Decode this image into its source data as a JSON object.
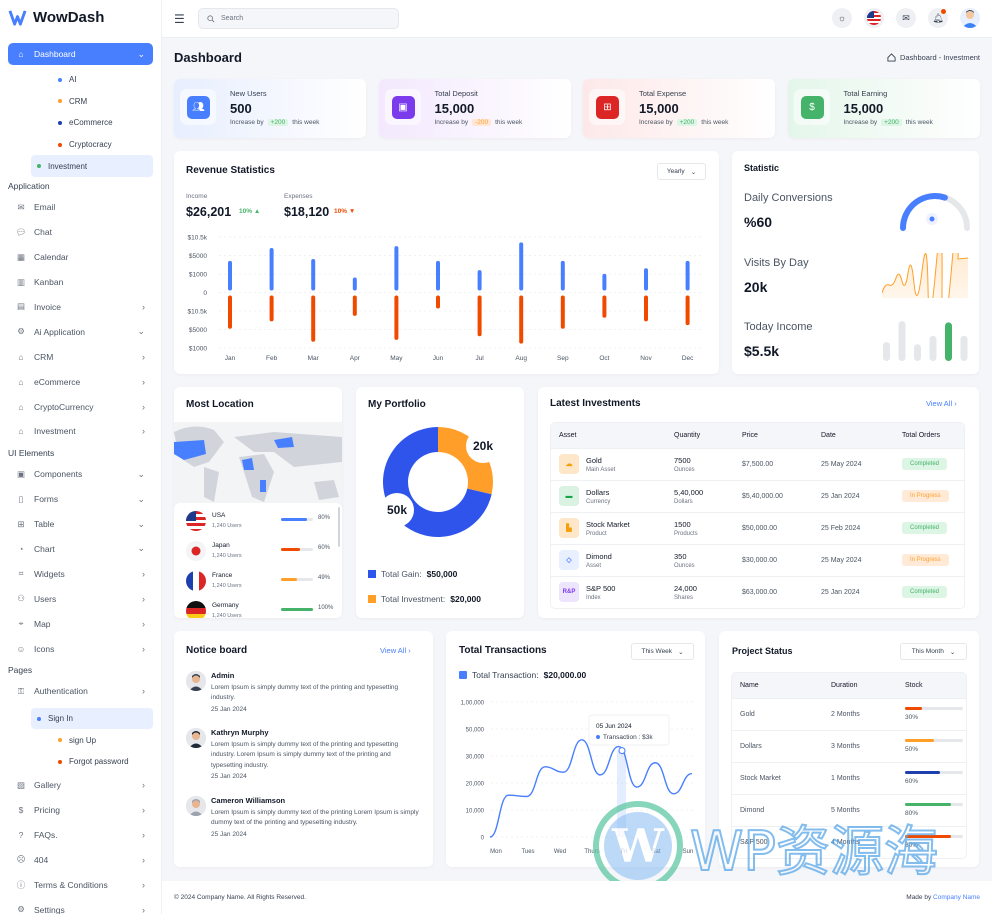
{
  "app": {
    "name": "WowDash"
  },
  "sidebar": {
    "dashboard": {
      "label": "Dashboard",
      "children": [
        {
          "label": "AI",
          "color": "#487fff"
        },
        {
          "label": "CRM",
          "color": "#ff9f29"
        },
        {
          "label": "eCommerce",
          "color": "#1e40af"
        },
        {
          "label": "Cryptocracy",
          "color": "#ef4a00"
        },
        {
          "label": "Investment",
          "color": "#45b369",
          "selected": true
        }
      ]
    },
    "section_application": "Application",
    "application": [
      {
        "label": "Email",
        "icon": "mail-icon"
      },
      {
        "label": "Chat",
        "icon": "chat-icon"
      },
      {
        "label": "Calendar",
        "icon": "calendar-icon"
      },
      {
        "label": "Kanban",
        "icon": "kanban-icon"
      },
      {
        "label": "Invoice",
        "icon": "invoice-icon",
        "chevron": "right"
      },
      {
        "label": "Ai Application",
        "icon": "ai-icon",
        "chevron": "down"
      },
      {
        "label": "CRM",
        "icon": "home-icon",
        "chevron": "right"
      },
      {
        "label": "eCommerce",
        "icon": "home-icon",
        "chevron": "right"
      },
      {
        "label": "CryptoCurrency",
        "icon": "home-icon",
        "chevron": "right"
      },
      {
        "label": "Investment",
        "icon": "home-icon",
        "chevron": "right"
      }
    ],
    "section_ui": "UI Elements",
    "ui": [
      {
        "label": "Components",
        "icon": "components-icon",
        "chevron": "down"
      },
      {
        "label": "Forms",
        "icon": "forms-icon",
        "chevron": "down"
      },
      {
        "label": "Table",
        "icon": "table-icon",
        "chevron": "down"
      },
      {
        "label": "Chart",
        "icon": "chart-icon",
        "chevron": "down"
      },
      {
        "label": "Widgets",
        "icon": "widgets-icon",
        "chevron": "right"
      },
      {
        "label": "Users",
        "icon": "users-icon",
        "chevron": "right"
      },
      {
        "label": "Map",
        "icon": "map-icon",
        "chevron": "right"
      },
      {
        "label": "Icons",
        "icon": "icons-icon",
        "chevron": "right"
      }
    ],
    "section_pages": "Pages",
    "authentication": {
      "label": "Authentication",
      "children": [
        {
          "label": "Sign In",
          "color": "#487fff",
          "selected": true
        },
        {
          "label": "sign Up",
          "color": "#ff9f29"
        },
        {
          "label": "Forgot password",
          "color": "#ef4a00"
        }
      ]
    },
    "pages": [
      {
        "label": "Gallery",
        "icon": "gallery-icon"
      },
      {
        "label": "Pricing",
        "icon": "pricing-icon"
      },
      {
        "label": "FAQs.",
        "icon": "faq-icon"
      },
      {
        "label": "404",
        "icon": "sad-face-icon"
      },
      {
        "label": "Terms & Conditions",
        "icon": "info-icon"
      },
      {
        "label": "Settings",
        "icon": "settings-icon"
      }
    ]
  },
  "topbar": {
    "search_placeholder": "Search"
  },
  "header": {
    "title": "Dashboard",
    "breadcrumb": "Dashboard - Investment"
  },
  "kpis": [
    {
      "label": "New Users",
      "value": "500",
      "prefix": "Increase by",
      "delta": "+200",
      "suffix": "this week",
      "trend": "up",
      "color": "#487fff"
    },
    {
      "label": "Total Deposit",
      "value": "15,000",
      "prefix": "Increase by",
      "delta": "-200",
      "suffix": "this week",
      "trend": "down",
      "color": "#7c3aed"
    },
    {
      "label": "Total Expense",
      "value": "15,000",
      "prefix": "Increase by",
      "delta": "+200",
      "suffix": "this week",
      "trend": "up",
      "color": "#dc2626"
    },
    {
      "label": "Total Earning",
      "value": "15,000",
      "prefix": "Increase by",
      "delta": "+200",
      "suffix": "this week",
      "trend": "up",
      "color": "#45b369"
    }
  ],
  "revenue": {
    "title": "Revenue Statistics",
    "period": "Yearly",
    "income_label": "Income",
    "income_value": "$26,201",
    "income_change": "10%",
    "expense_label": "Expenses",
    "expense_value": "$18,120",
    "expense_change": "10%"
  },
  "chart_data": [
    {
      "type": "bar",
      "title": "Revenue Statistics",
      "categories": [
        "Jan",
        "Feb",
        "Mar",
        "Apr",
        "May",
        "Jun",
        "Jul",
        "Aug",
        "Sep",
        "Oct",
        "Nov",
        "Dec"
      ],
      "y_tick_labels": [
        "$10.5k",
        "$5000",
        "$1000",
        "0",
        "$10.5k",
        "$5000",
        "$1000"
      ],
      "y_range_gridsteps": [
        -3,
        3
      ],
      "series": [
        {
          "name": "Income",
          "color": "#487fff",
          "values": [
            1.6,
            2.3,
            1.7,
            0.7,
            2.4,
            1.6,
            1.1,
            2.6,
            1.6,
            0.9,
            1.2,
            1.6
          ]
        },
        {
          "name": "Expenses",
          "color": "#ef4a00",
          "values": [
            -1.8,
            -1.4,
            -2.5,
            -1.1,
            -2.4,
            -0.7,
            -2.2,
            -2.6,
            -1.8,
            -1.2,
            -1.4,
            -1.6
          ]
        }
      ],
      "grid": true
    },
    {
      "type": "pie",
      "title": "My Portfolio",
      "categories": [
        "Total Gain",
        "Total Investment"
      ],
      "values": [
        50000,
        20000
      ],
      "labels": [
        "50k",
        "20k"
      ],
      "colors": [
        "#2f54eb",
        "#ff9f29"
      ]
    },
    {
      "type": "line",
      "title": "Total Transactions",
      "x": [
        "Mon",
        "Tues",
        "Wed",
        "Thurs",
        "Fri",
        "Sat",
        "Sun"
      ],
      "y_tick_labels": [
        "0",
        "10,000",
        "20,000",
        "30,000",
        "50,000",
        "1,00,000"
      ],
      "y_tick_values": [
        0,
        1,
        2,
        3,
        4,
        5
      ],
      "values_gridunits": [
        0,
        1.55,
        1.5,
        2.6,
        2.4,
        3.6,
        2.3,
        3.35,
        1.85,
        2.75,
        1.6,
        2.35
      ],
      "tooltip": {
        "title": "05 Jun 2024",
        "label": "Transaction : $3k"
      },
      "color": "#487fff"
    }
  ],
  "statistic": {
    "title": "Statistic",
    "items": [
      {
        "label": "Daily Conversions",
        "value": "%60",
        "gauge_percent": 60
      },
      {
        "label": "Visits By Day",
        "value": "20k"
      },
      {
        "label": "Today Income",
        "value": "$5.5k",
        "bars": [
          0.45,
          0.95,
          0.4,
          0.6,
          0.92,
          0.6
        ],
        "highlight_index": 4
      }
    ]
  },
  "location": {
    "title": "Most Location",
    "rows": [
      {
        "country": "USA",
        "users": "1,240 Users",
        "percent": 80,
        "pct_label": "80%",
        "color": "#487fff"
      },
      {
        "country": "Japan",
        "users": "1,240 Users",
        "percent": 60,
        "pct_label": "60%",
        "color": "#ef4a00"
      },
      {
        "country": "France",
        "users": "1,240 Users",
        "percent": 49,
        "pct_label": "49%",
        "color": "#ff9f29"
      },
      {
        "country": "Germany",
        "users": "1,240 Users",
        "percent": 100,
        "pct_label": "100%",
        "color": "#45b369"
      }
    ]
  },
  "portfolio": {
    "title": "My Portfolio",
    "label_gain": "50k",
    "label_invest": "20k",
    "legend_gain": "Total Gain:",
    "legend_gain_value": "$50,000",
    "legend_invest": "Total Investment:",
    "legend_invest_value": "$20,000"
  },
  "investments": {
    "title": "Latest Investments",
    "view_all": "View All",
    "columns": [
      "Asset",
      "Quantity",
      "Price",
      "Date",
      "Total Orders"
    ],
    "rows": [
      {
        "name": "Gold",
        "sub": "Main Asset",
        "qty": "7500",
        "unit": "Ounces",
        "price": "$7,500.00",
        "date": "25 May 2024",
        "status": "Completed",
        "icon": "gold-icon"
      },
      {
        "name": "Dollars",
        "sub": "Currency",
        "qty": "5,40,000",
        "unit": "Dollars",
        "price": "$5,40,000.00",
        "date": "25 Jan 2024",
        "status": "In Progress",
        "icon": "dollar-icon"
      },
      {
        "name": "Stock Market",
        "sub": "Product",
        "qty": "1500",
        "unit": "Products",
        "price": "$50,000.00",
        "date": "25 Feb 2024",
        "status": "Completed",
        "icon": "stock-icon"
      },
      {
        "name": "Dimond",
        "sub": "Asset",
        "qty": "350",
        "unit": "Ounces",
        "price": "$30,000.00",
        "date": "25 May 2024",
        "status": "In Progress",
        "icon": "diamond-icon"
      },
      {
        "name": "S&P 500",
        "sub": "Index",
        "qty": "24,000",
        "unit": "Shares",
        "price": "$63,000.00",
        "date": "25 Jan 2024",
        "status": "Completed",
        "icon": "rp-icon",
        "icon_text": "R&P"
      }
    ]
  },
  "notice": {
    "title": "Notice board",
    "view_all": "View All",
    "items": [
      {
        "name": "Admin",
        "text": "Lorem Ipsum is simply dummy text of the printing and typesetting industry.",
        "date": "25 Jan 2024"
      },
      {
        "name": "Kathryn Murphy",
        "text": "Lorem Ipsum is simply dummy text of the printing and typesetting industry. Lorem Ipsum is simply dummy text of the printing and typesetting industry.",
        "date": "25 Jan 2024"
      },
      {
        "name": "Cameron Williamson",
        "text": "Lorem Ipsum is simply dummy text of the printing Lorem Ipsum is simply dummy text of the printing and typesetting industry.",
        "date": "25 Jan 2024"
      }
    ]
  },
  "transactions": {
    "title": "Total Transactions",
    "period": "This Week",
    "legend": "Total Transaction:",
    "legend_value": "$20,000.00"
  },
  "project_status": {
    "title": "Project Status",
    "period": "This Month",
    "columns": [
      "Name",
      "Duration",
      "Stock"
    ],
    "rows": [
      {
        "name": "Gold",
        "duration": "2 Months",
        "percent": 30,
        "label": "30%",
        "color": "#ef4a00"
      },
      {
        "name": "Dollars",
        "duration": "3 Months",
        "percent": 50,
        "label": "50%",
        "color": "#ff9f29"
      },
      {
        "name": "Stock Market",
        "duration": "1 Months",
        "percent": 60,
        "label": "60%",
        "color": "#1e40af"
      },
      {
        "name": "Dimond",
        "duration": "5 Months",
        "percent": 80,
        "label": "80%",
        "color": "#45b369"
      },
      {
        "name": "S&P 500",
        "duration": "4 Months",
        "percent": 80,
        "label": "80%",
        "color": "#ef4a00"
      }
    ]
  },
  "footer": {
    "copyright": "© 2024 Company Name. All Rights Reserved.",
    "made_by": "Made by",
    "company": "Company Name"
  },
  "watermark": "WP资源海"
}
